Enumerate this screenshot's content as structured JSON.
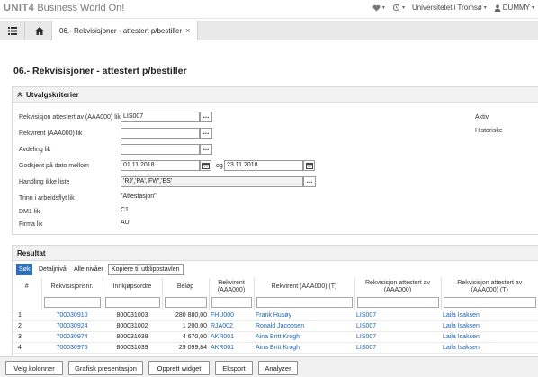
{
  "app": {
    "brand_logo": "UNIT4",
    "brand_name": "Business World On!",
    "organization": "Universitetet i Tromsø",
    "user": "DUMMY"
  },
  "tabs": {
    "active_label": "06.- Rekvisisjoner - attestert p/bestiller"
  },
  "page": {
    "title": "06.- Rekvisisjoner - attestert p/bestiller"
  },
  "criteria": {
    "title": "Utvalgskriterier",
    "rows": [
      {
        "label": "Rekvisisjon attestert av (AAA000) lik",
        "value": "LIS007"
      },
      {
        "label": "Rekvirent (AAA000) lik",
        "value": ""
      },
      {
        "label": "Avdeling lik",
        "value": ""
      },
      {
        "label": "Godkjent på dato mellom",
        "value": "01.11.2018",
        "connector": "og",
        "value2": "23.11.2018"
      },
      {
        "label": "Handling ikke liste",
        "value": "'RJ','PA','FW','ES'"
      },
      {
        "label": "Trinn i arbeidsflyt lik",
        "value": "\"Attestasjon\""
      },
      {
        "label": "DM1 lik",
        "value": "C1"
      },
      {
        "label": "Firma lik",
        "value": "AU"
      }
    ],
    "side_options": [
      "Aktiv",
      "Historiske"
    ]
  },
  "results": {
    "title": "Resultat",
    "toolbar": {
      "search": "Søk",
      "detail": "Detaljnivå",
      "all_levels": "Alle nivåer",
      "copy": "Kopiere til utklippstavlen"
    },
    "columns": [
      "#",
      "Rekvisisjonsnr.",
      "Innkjøpsordre",
      "Beløp",
      "Rekvirent (AAA000)",
      "Rekvirent (AAA000) (T)",
      "Rekvisisjon attestert av (AAA000)",
      "Rekvisisjon attestert av (AAA000) (T)"
    ],
    "rows": [
      [
        "1",
        "700030910",
        "800031003",
        "280 880,00",
        "FHU000",
        "Frank Husøy",
        "LIS007",
        "Laila Isaksen"
      ],
      [
        "2",
        "700030924",
        "800031002",
        "1 200,00",
        "RJA002",
        "Ronald Jacobsen",
        "LIS007",
        "Laila Isaksen"
      ],
      [
        "3",
        "700030974",
        "800031038",
        "4 670,00",
        "AKR001",
        "Aina Britt Krogh",
        "LIS007",
        "Laila Isaksen"
      ],
      [
        "4",
        "700030976",
        "800031039",
        "29 099,84",
        "AKR001",
        "Aina Britt Krogh",
        "LIS007",
        "Laila Isaksen"
      ]
    ]
  },
  "bottom": {
    "select_columns": "Velg kolonner",
    "graphic": "Grafisk presentasjon",
    "create_widget": "Opprett widget",
    "export": "Eksport",
    "analyze": "Analyzer"
  }
}
